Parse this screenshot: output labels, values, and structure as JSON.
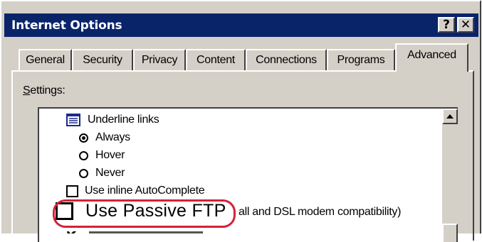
{
  "window": {
    "title": "Internet Options",
    "help_button": "?",
    "close_button": "✕"
  },
  "tabs": [
    {
      "label": "General"
    },
    {
      "label": "Security"
    },
    {
      "label": "Privacy"
    },
    {
      "label": "Content"
    },
    {
      "label": "Connections"
    },
    {
      "label": "Programs"
    },
    {
      "label": "Advanced",
      "active": true
    }
  ],
  "settings": {
    "label": "Settings:",
    "items": [
      {
        "type": "group",
        "icon": "settings-group-icon",
        "label": "Underline links"
      },
      {
        "type": "radio",
        "label": "Always",
        "checked": true
      },
      {
        "type": "radio",
        "label": "Hover",
        "checked": false
      },
      {
        "type": "radio",
        "label": "Never",
        "checked": false
      },
      {
        "type": "checkbox",
        "label": "Use inline AutoComplete",
        "checked": false
      },
      {
        "type": "checkbox",
        "label": "Use Passive FTP",
        "trailing": "all and DSL modem compatibility)",
        "checked": false,
        "highlighted": true
      }
    ]
  },
  "colors": {
    "title_bar": "#0a246a",
    "window_face": "#d4d0c8",
    "highlight_ring": "#d4213a"
  }
}
